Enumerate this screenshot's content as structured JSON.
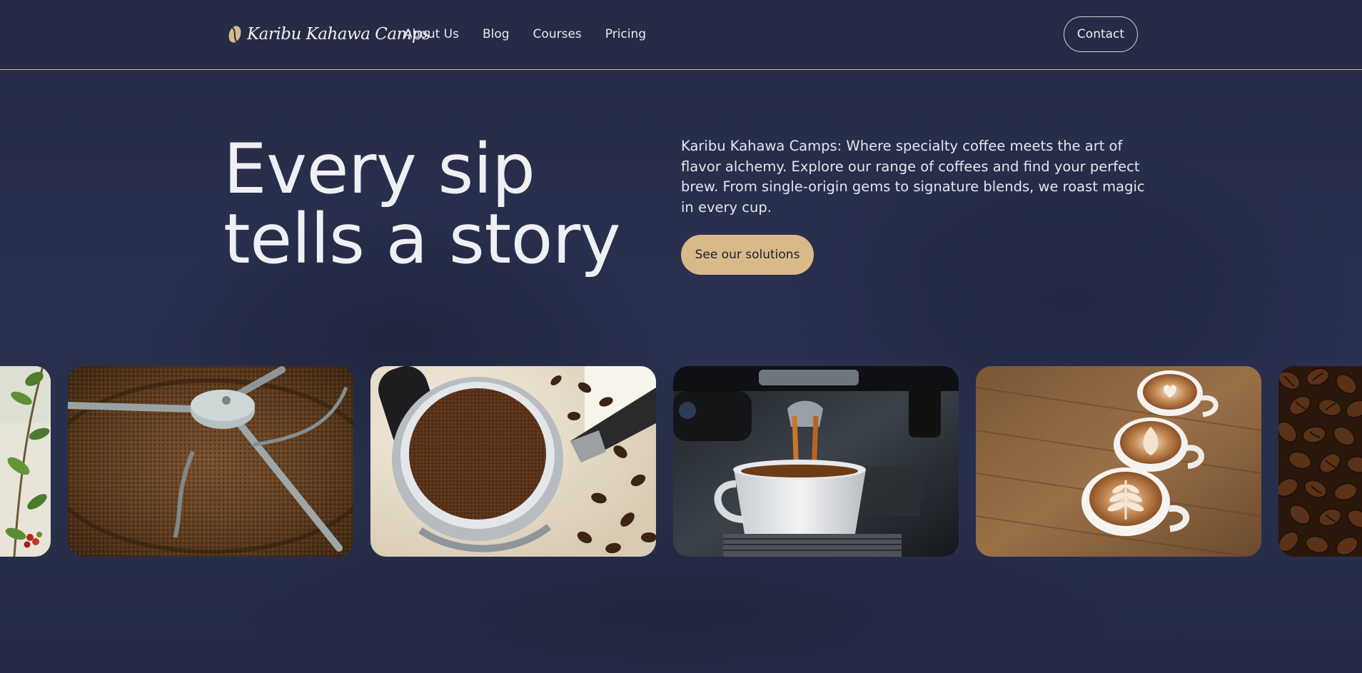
{
  "brand": {
    "name": "Karibu Kahawa Camps",
    "logo_icon": "coffee-bean-icon",
    "accent": "#d9b98a"
  },
  "nav": {
    "items": [
      {
        "label": "About Us"
      },
      {
        "label": "Blog"
      },
      {
        "label": "Courses"
      },
      {
        "label": "Pricing"
      }
    ],
    "contact_label": "Contact"
  },
  "hero": {
    "title_line1": "Every sip",
    "title_line2": "tells a story",
    "description": "Karibu Kahawa Camps: Where specialty coffee meets the art of flavor alchemy. Explore our range of coffees and find your perfect brew. From single-origin gems to signature blends, we roast magic in every cup.",
    "cta_label": "See our solutions"
  },
  "gallery": {
    "photos": [
      {
        "subject": "coffee plant branch with cherries"
      },
      {
        "subject": "coffee roaster cooling tray with beans"
      },
      {
        "subject": "portafilter filled with ground coffee"
      },
      {
        "subject": "espresso pouring into white cup"
      },
      {
        "subject": "three latte art cups on wooden table"
      },
      {
        "subject": "roasted coffee beans close-up"
      }
    ]
  },
  "colors": {
    "background": "#262c45",
    "header_rule": "#d6b991",
    "cta_background": "#d9b98a"
  }
}
